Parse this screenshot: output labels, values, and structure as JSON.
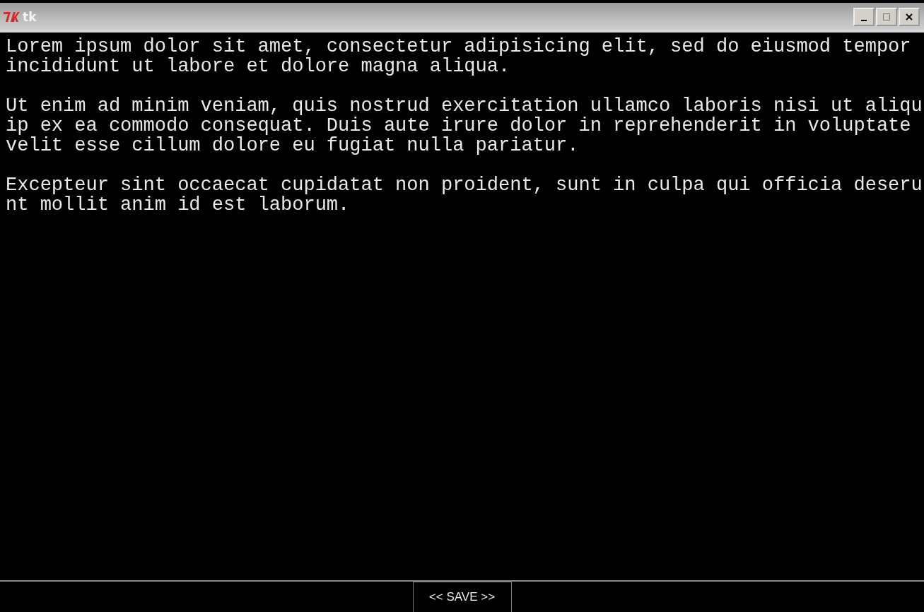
{
  "window": {
    "title": "tk"
  },
  "text_area": {
    "paragraphs": [
      {
        "lines": [
          "Lorem ipsum dolor sit amet, consectetur adipisicing elit, sed do eiusmod tempor",
          "incididunt ut labore et dolore magna aliqua."
        ]
      },
      {
        "lines": [
          "Ut enim ad minim veniam, quis nostrud exercitation ullamco laboris nisi ut aliqu",
          "ip ex ea commodo consequat. Duis aute irure dolor in reprehenderit in voluptate",
          "velit esse cillum dolore eu fugiat nulla pariatur."
        ]
      },
      {
        "lines": [
          "Excepteur sint occaecat cupidatat non proident, sunt in culpa qui officia deseru",
          "nt mollit anim id est laborum."
        ]
      }
    ]
  },
  "buttons": [
    {
      "label": "<< SAVE >>"
    }
  ]
}
